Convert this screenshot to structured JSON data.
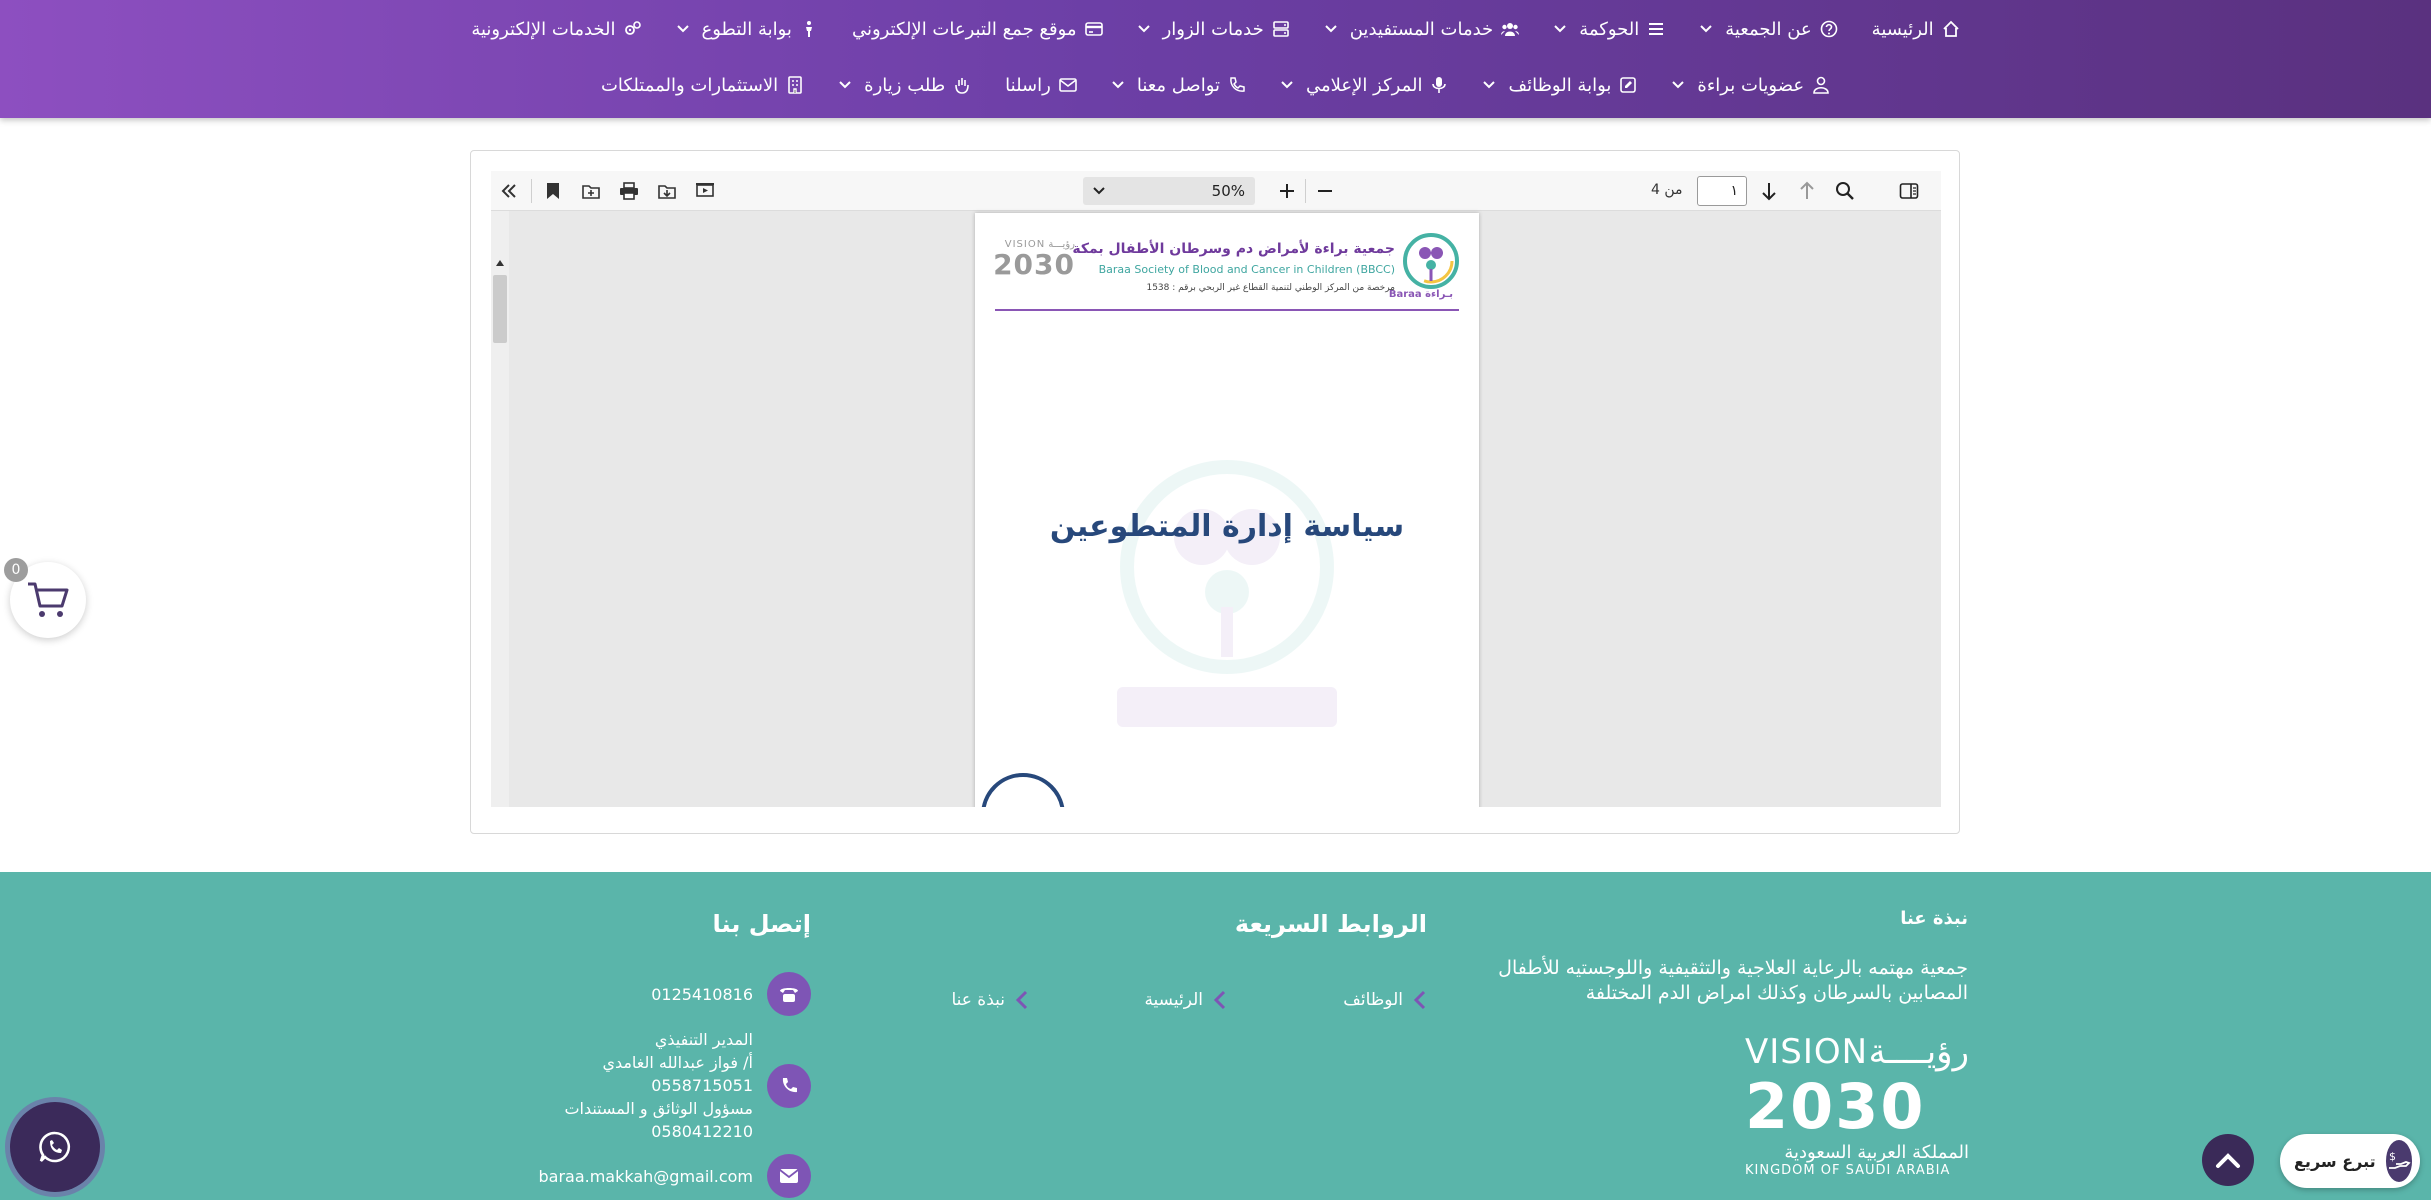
{
  "nav": {
    "row1": [
      {
        "label": "الرئيسية",
        "icon": "home-icon",
        "dropdown": false
      },
      {
        "label": "عن الجمعية",
        "icon": "question-circle-icon",
        "dropdown": true
      },
      {
        "label": "الحوكمة",
        "icon": "list-icon",
        "dropdown": true
      },
      {
        "label": "خدمات المستفيدين",
        "icon": "users-icon",
        "dropdown": true
      },
      {
        "label": "خدمات الزوار",
        "icon": "server-icon",
        "dropdown": true
      },
      {
        "label": "موقع جمع التبرعات الإلكتروني",
        "icon": "credit-card-icon",
        "dropdown": false
      },
      {
        "label": "بوابة التطوع",
        "icon": "person-icon",
        "dropdown": true
      },
      {
        "label": "الخدمات الإلكترونية",
        "icon": "gears-icon",
        "dropdown": false
      }
    ],
    "row2": [
      {
        "label": "عضويات براءة",
        "icon": "user-icon",
        "dropdown": true
      },
      {
        "label": "بوابة الوظائف",
        "icon": "edit-icon",
        "dropdown": true
      },
      {
        "label": "المركز الإعلامي",
        "icon": "microphone-icon",
        "dropdown": true
      },
      {
        "label": "تواصل معنا",
        "icon": "phone-icon",
        "dropdown": true
      },
      {
        "label": "راسلنا",
        "icon": "envelope-icon",
        "dropdown": false
      },
      {
        "label": "طلب زيارة",
        "icon": "hand-icon",
        "dropdown": true
      },
      {
        "label": "الاستثمارات والممتلكات",
        "icon": "building-icon",
        "dropdown": false
      }
    ]
  },
  "pdf_viewer": {
    "zoom": "50%",
    "page_current": "١",
    "page_of": "من 4",
    "document": {
      "org_ar": "جمعية براءة لأمراض دم وسرطان الأطفال بمكة",
      "org_en": "Baraa Society of Blood and Cancer in Children (BBCC)",
      "registration": "مرخصة من المركز الوطني لتنمية القطاع غير الربحي برقم : 1538",
      "logo_text": "بـراءة Baraa",
      "vision_top": "رؤيـــة VISION",
      "vision_year": "2030",
      "title": "سياسة إدارة المتطوعين"
    }
  },
  "cart": {
    "count": "0"
  },
  "footer": {
    "about_title": "نبذة عنا",
    "about_text": "جمعية مهتمه بالرعاية العلاجية والتثقيفية واللوجستيه للأطفال المصابين بالسرطان وكذلك امراض الدم المختلفة",
    "vision": {
      "top_ar": "رؤيــــة",
      "top_en": "VISION",
      "year": "2030",
      "country_ar": "المملكة العربية السعودية",
      "country_en": "KINGDOM OF SAUDI ARABIA"
    },
    "links_title": "الروابط السريعة",
    "links": [
      "الوظائف",
      "الرئيسية",
      "نبذة عنا"
    ],
    "contact_title": "إتصل بنا",
    "phone": "0125410816",
    "manager_lines": [
      "المدير التنفيذي",
      "أ/ فواز عبدالله الغامدي",
      "0558715051",
      "مسؤول الوثائق و المستندات",
      "0580412210"
    ],
    "email": "baraa.makkah@gmail.com"
  },
  "donate": {
    "label": "تبرع سريع"
  },
  "colors": {
    "nav_start": "#8d4fc0",
    "nav_end": "#5a317f",
    "footer": "#5ab5aa",
    "accent_purple": "#7e55b5",
    "doc_title": "#27487b"
  }
}
